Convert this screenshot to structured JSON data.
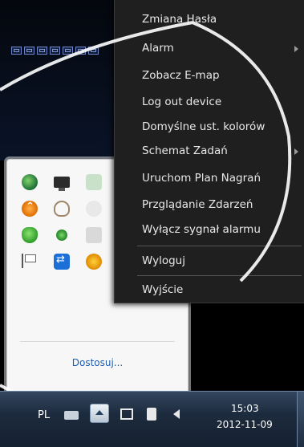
{
  "context_menu": {
    "items": [
      {
        "label": "Zmiana Hasła",
        "submenu": false
      },
      {
        "label": "Alarm",
        "submenu": true
      },
      {
        "label": "Zobacz E-map",
        "submenu": false
      },
      {
        "label": "Log out device",
        "submenu": false
      },
      {
        "label": "Domyślne ust. kolorów",
        "submenu": false
      },
      {
        "label": "Schemat Zadań",
        "submenu": true
      },
      {
        "label": "Uruchom Plan Nagrań",
        "submenu": false
      },
      {
        "label": "Przglądanie Zdarzeń",
        "submenu": false
      },
      {
        "label": "Wyłącz sygnał alarmu",
        "submenu": false
      },
      {
        "label": "Wyloguj",
        "submenu": false
      },
      {
        "label": "Wyjście",
        "submenu": false
      }
    ]
  },
  "tray_popup": {
    "customize_link": "Dostosuj...",
    "icons": [
      "globe-icon",
      "monitor-icon",
      "app-icon",
      "updates-icon",
      "fingerprint-icon",
      "app-icon",
      "shield-icon",
      "status-icon",
      "app-icon",
      "flag-icon",
      "teamviewer-icon",
      "sun-icon",
      "network-icon"
    ]
  },
  "taskbar": {
    "language": "PL",
    "time": "15:03",
    "date": "2012-11-09"
  }
}
